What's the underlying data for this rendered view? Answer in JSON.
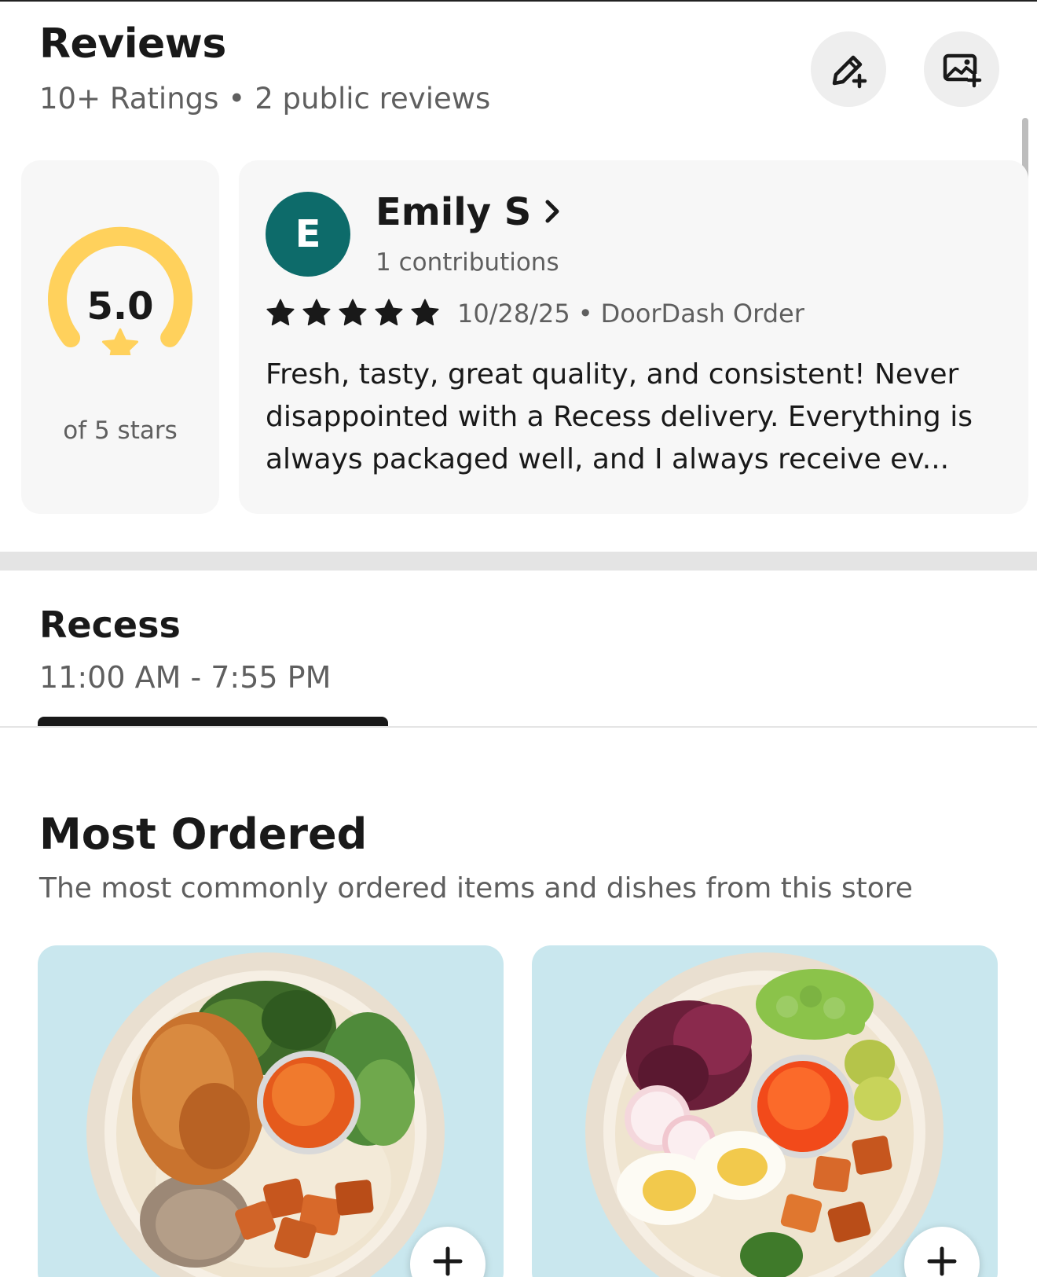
{
  "reviews": {
    "title": "Reviews",
    "ratings_count": "10+ Ratings",
    "separator": "•",
    "public_reviews": "2 public reviews",
    "write_review_icon": "edit-pencil-plus-icon",
    "add_photo_icon": "add-photo-icon"
  },
  "rating_summary": {
    "value": "5.0",
    "caption": "of 5 stars",
    "gauge_fraction": 1.0,
    "gauge_color": "#FFD15C",
    "star_icon": "star-icon"
  },
  "review": {
    "avatar_initial": "E",
    "avatar_color": "#0D6B6A",
    "reviewer_name": "Emily S",
    "contributions": "1 contributions",
    "stars": 5,
    "date": "10/28/25",
    "separator": "•",
    "source": "DoorDash Order",
    "text": "Fresh, tasty, great quality, and consistent! Never disappointed with a Recess delivery. Everything is always packaged well, and I always receive ev..."
  },
  "store": {
    "name": "Recess",
    "hours": "11:00 AM - 7:55 PM"
  },
  "most_ordered": {
    "title": "Most Ordered",
    "subtitle": "The most commonly ordered items and dishes from this store",
    "items": [
      {
        "image_icon": "chicken-bowl-image",
        "add_icon": "plus-icon"
      },
      {
        "image_icon": "veggie-egg-bowl-image",
        "add_icon": "plus-icon"
      }
    ]
  }
}
